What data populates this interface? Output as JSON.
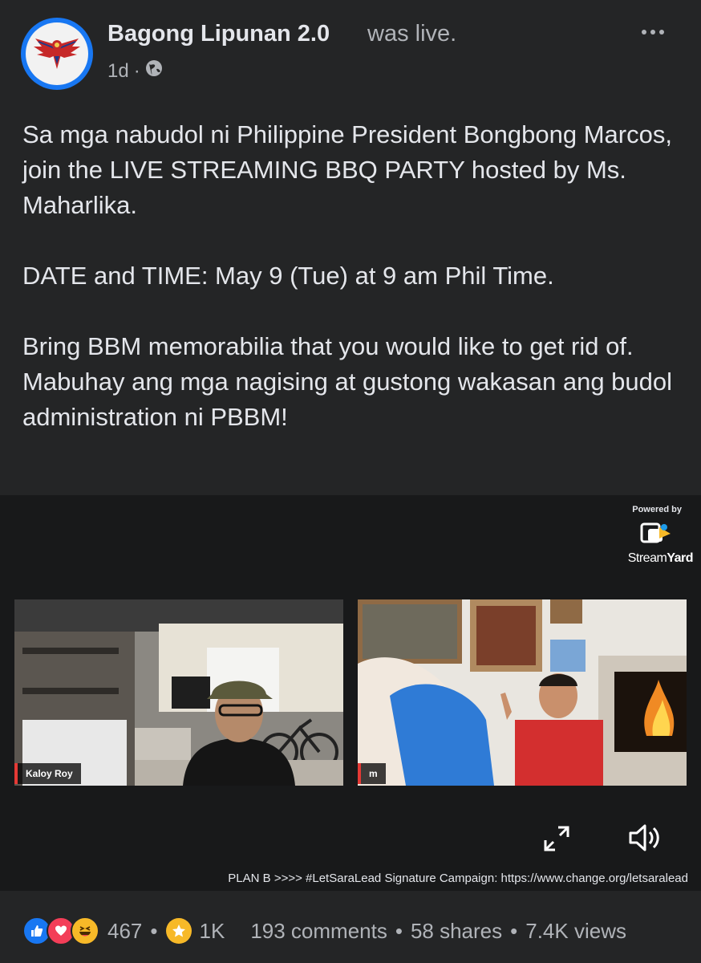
{
  "header": {
    "page_name": "Bagong Lipunan 2.0",
    "status": "was live.",
    "time": "1d",
    "separator": "·"
  },
  "post": {
    "paragraph1": "Sa mga nabudol ni Philippine President Bongbong Marcos, join the LIVE STREAMING BBQ PARTY hosted by Ms. Maharlika.",
    "paragraph2": "DATE and TIME: May 9 (Tue) at 9 am Phil Time.",
    "paragraph3_line1": "Bring BBM memorabilia that you would like to get rid of.",
    "paragraph3_line2": "Mabuhay ang mga nagising at gustong wakasan ang budol administration ni PBBM!"
  },
  "video": {
    "powered_by": "Powered by",
    "brand_part1": "Stream",
    "brand_part2": "Yard",
    "left_participant": "Kaloy Roy",
    "right_participant": "m",
    "banner": "PLAN B >>>> #LetSaraLead Signature Campaign: https://www.change.org/letsaralead"
  },
  "footer": {
    "reaction_count": "467",
    "stars_count": "1K",
    "comments": "193 comments",
    "shares": "58 shares",
    "views": "7.4K views",
    "dot": "•"
  },
  "colors": {
    "background": "#242526",
    "text": "#e4e6eb",
    "muted": "#b0b3b8",
    "accent": "#1877f2",
    "live_red": "#e53935"
  },
  "icons": [
    "more-options-icon",
    "globe-icon",
    "expand-icon",
    "volume-icon",
    "like-reaction-icon",
    "love-reaction-icon",
    "haha-reaction-icon",
    "stars-icon"
  ]
}
